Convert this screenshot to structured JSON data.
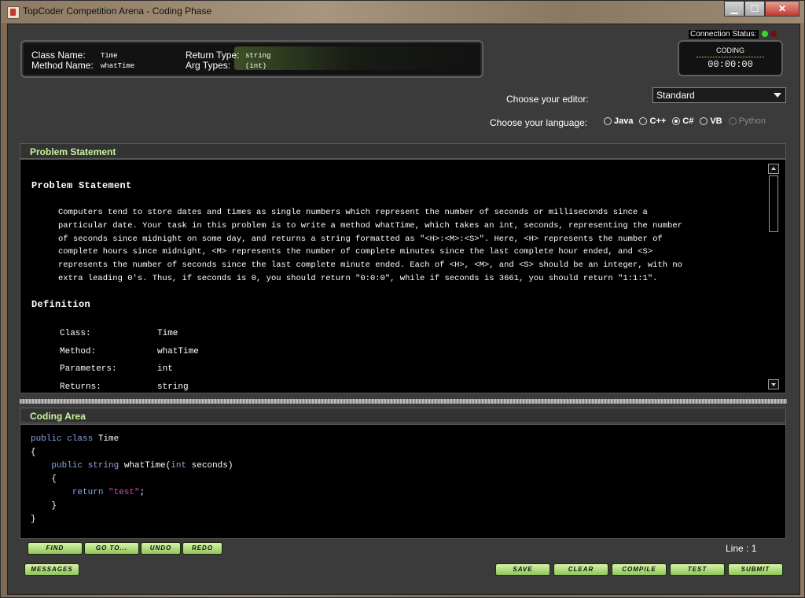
{
  "window": {
    "title": "TopCoder Competition Arena - Coding Phase",
    "min_label": "▁",
    "max_label": "☐",
    "close_label": "✕"
  },
  "problem_info": {
    "class_name_label": "Class Name:",
    "class_name_value": "Time",
    "method_name_label": "Method Name:",
    "method_name_value": "whatTime",
    "return_type_label": "Return Type:",
    "return_type_value": "string",
    "arg_types_label": "Arg Types:",
    "arg_types_value": "(int)"
  },
  "status": {
    "connection_label": "Connection Status:",
    "phase": "CODING",
    "timer": "00:00:00"
  },
  "editor": {
    "label": "Choose your editor:",
    "selected": "Standard"
  },
  "language": {
    "label": "Choose your language:",
    "options": [
      {
        "name": "Java",
        "selected": false,
        "enabled": true
      },
      {
        "name": "C++",
        "selected": false,
        "enabled": true
      },
      {
        "name": "C#",
        "selected": true,
        "enabled": true
      },
      {
        "name": "VB",
        "selected": false,
        "enabled": true
      },
      {
        "name": "Python",
        "selected": false,
        "enabled": false
      }
    ]
  },
  "statement": {
    "panel_title": "Problem Statement",
    "heading": "Problem Statement",
    "paragraph_lines": [
      "Computers tend to store dates and times as single numbers which represent the number of seconds or milliseconds since a",
      "particular date. Your task in this problem is to write a method whatTime, which takes an int, seconds, representing the number",
      "of seconds since midnight on some day, and returns a string formatted as \"<H>:<M>:<S>\". Here, <H> represents the number of",
      "complete hours since midnight, <M> represents the number of complete minutes since the last complete hour ended, and <S>",
      "represents the number of seconds since the last complete minute ended. Each of <H>, <M>, and <S> should be an integer, with no",
      "extra leading 0's. Thus, if seconds is 0, you should return \"0:0:0\", while if seconds is 3661, you should return \"1:1:1\"."
    ],
    "definition_heading": "Definition",
    "definition": [
      {
        "label": "Class:",
        "value": "Time"
      },
      {
        "label": "Method:",
        "value": "whatTime"
      },
      {
        "label": "Parameters:",
        "value": "int"
      },
      {
        "label": "Returns:",
        "value": "string"
      }
    ]
  },
  "coding": {
    "panel_title": "Coding Area",
    "line_status": "Line : 1"
  },
  "buttons": {
    "find": "Find",
    "goto": "Go to...",
    "undo": "Undo",
    "redo": "Redo",
    "messages": "Messages",
    "save": "Save",
    "clear": "Clear",
    "compile": "Compile",
    "test": "Test",
    "submit": "Submit"
  },
  "colors": {
    "panel_title": "#c6f59a",
    "button_green": "#b5e084",
    "keyword": "#8fa5e6",
    "string": "#e044d4"
  }
}
